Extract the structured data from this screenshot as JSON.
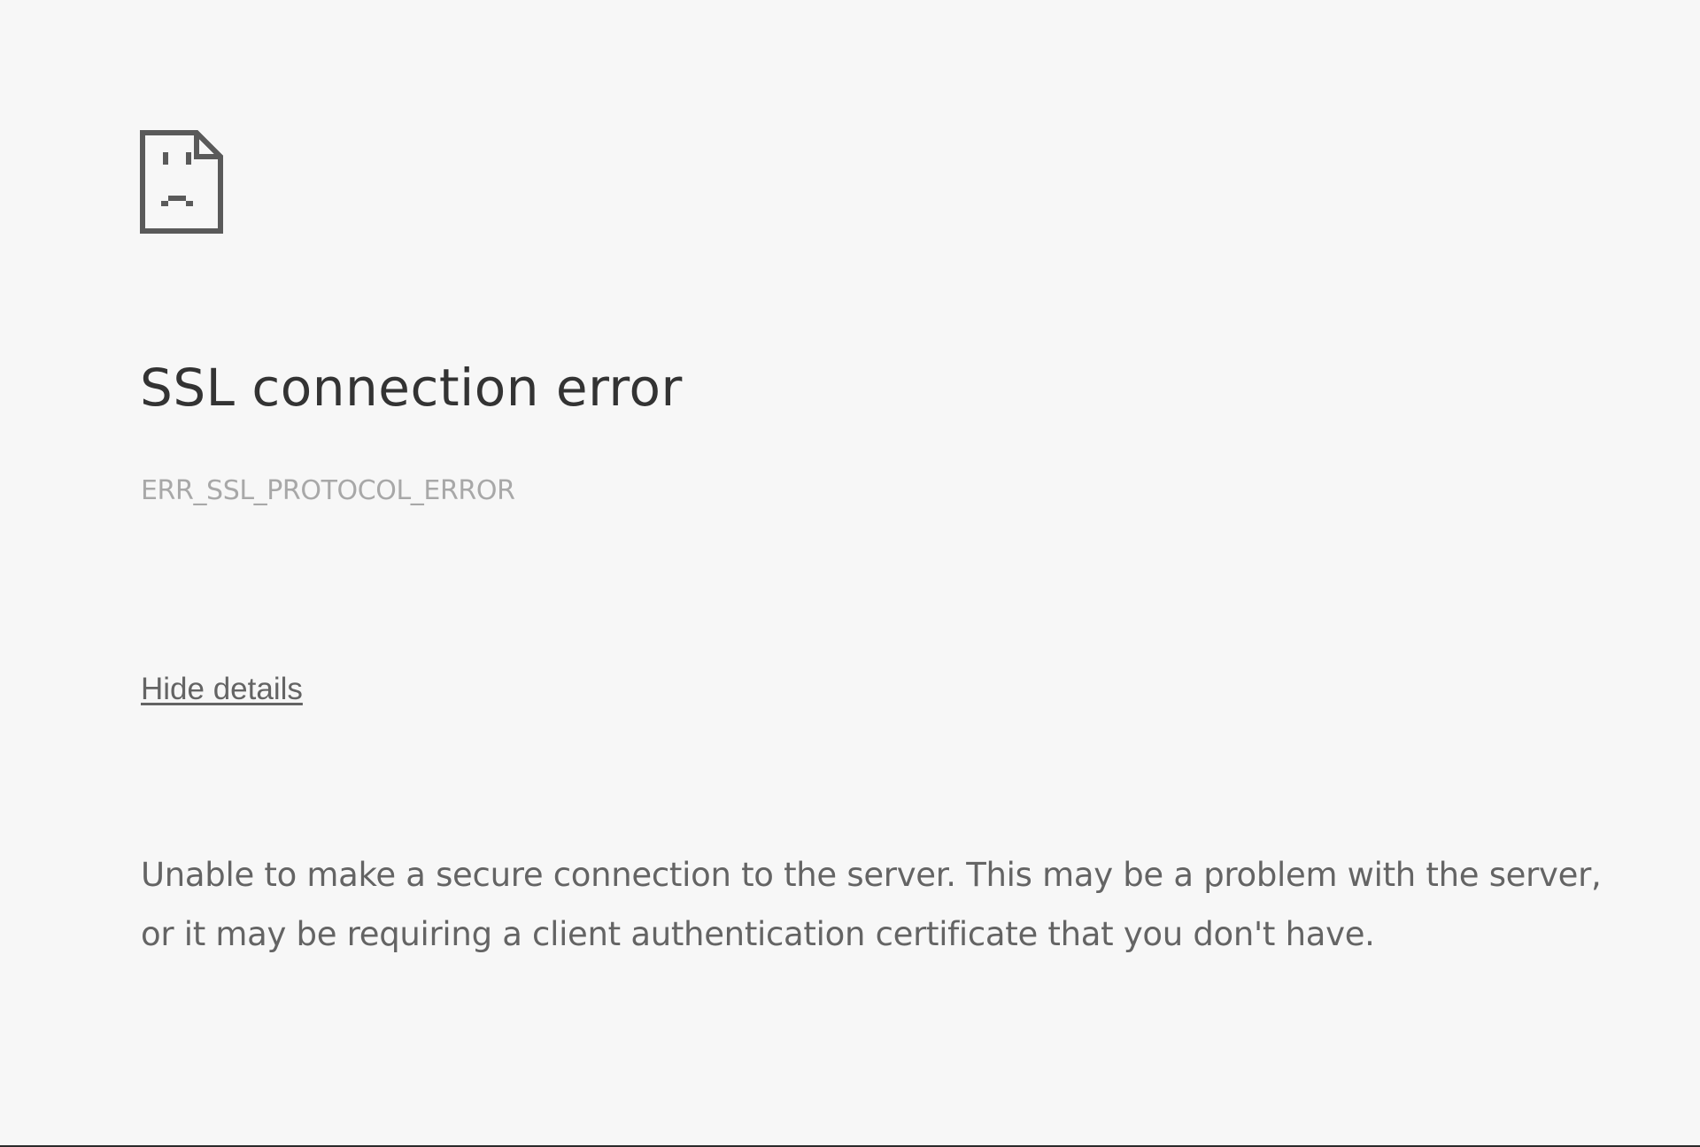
{
  "icon": {
    "name": "sad-page-icon",
    "color": "#5a5a5a"
  },
  "error": {
    "title": "SSL connection error",
    "code": "ERR_SSL_PROTOCOL_ERROR",
    "details_toggle": "Hide details",
    "explanation_line1": "Unable to make a secure connection to the server. This may be a problem with the server,",
    "explanation_line2": "or it may be requiring a client authentication certificate that you don't have."
  },
  "colors": {
    "background": "#f7f7f7",
    "title": "#333333",
    "code": "#a8a8a8",
    "body_text": "#646464"
  }
}
